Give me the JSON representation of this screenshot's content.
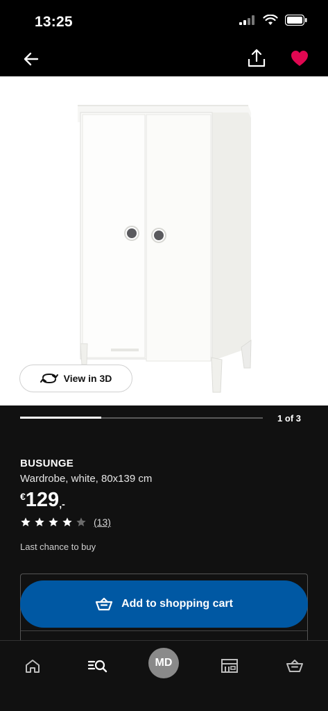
{
  "status_bar": {
    "time": "13:25"
  },
  "nav": {
    "back_icon": "arrow-left-icon",
    "share_icon": "share-icon",
    "favorite_icon": "heart-icon",
    "favorite_color": "#e00751"
  },
  "product_view": {
    "view_3d_label": "View in 3D"
  },
  "carousel": {
    "counter": "1 of 3",
    "progress_fraction": 0.333
  },
  "product": {
    "name": "BUSUNGE",
    "description": "Wardrobe, white, 80x139 cm",
    "price_currency": "€",
    "price_amount": "129",
    "price_suffix": ",-",
    "rating_stars": 4,
    "rating_max": 5,
    "review_count": "(13)",
    "availability": "Last chance to buy"
  },
  "cart": {
    "add_label": "Add to shopping cart",
    "button_color": "#0058a3"
  },
  "tab_bar": {
    "items": [
      {
        "icon": "home-icon"
      },
      {
        "icon": "search-icon"
      },
      {
        "avatar_initials": "MD"
      },
      {
        "icon": "store-icon"
      },
      {
        "icon": "basket-icon"
      }
    ]
  }
}
